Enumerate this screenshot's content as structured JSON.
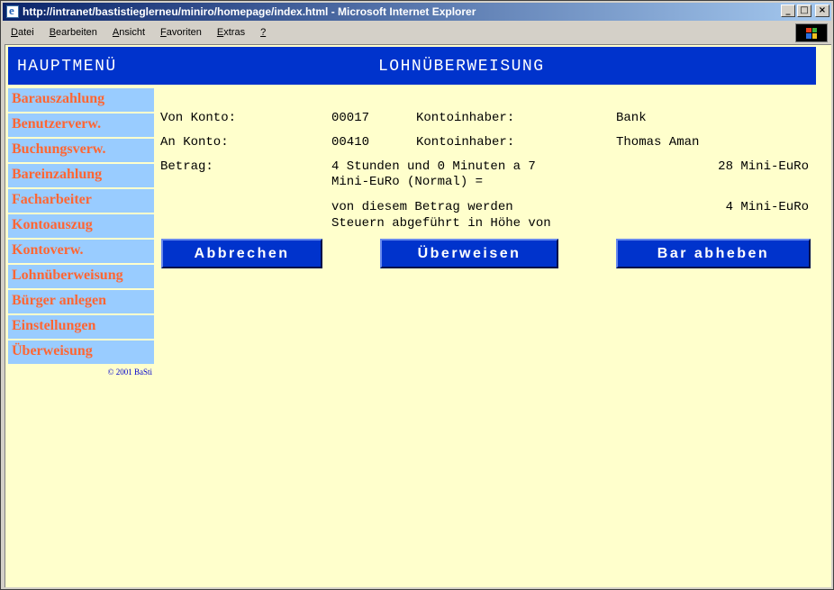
{
  "window": {
    "title": "http://intranet/bastistieglerneu/miniro/homepage/index.html - Microsoft Internet Explorer",
    "min_label": "_",
    "max_label": "□",
    "close_label": "×"
  },
  "menubar": [
    {
      "underline": "D",
      "rest": "atei"
    },
    {
      "underline": "B",
      "rest": "earbeiten"
    },
    {
      "underline": "A",
      "rest": "nsicht"
    },
    {
      "underline": "F",
      "rest": "avoriten"
    },
    {
      "underline": "E",
      "rest": "xtras"
    },
    {
      "underline": "?",
      "rest": ""
    }
  ],
  "header": {
    "left_title": "HAUPTMENÜ",
    "right_title": "LOHNÜBERWEISUNG"
  },
  "sidebar": {
    "items": [
      "Barauszahlung",
      "Benutzerverw.",
      "Buchungsverw.",
      "Bareinzahlung",
      "Facharbeiter",
      "Kontoauszug",
      "Kontoverw.",
      "Lohnüberweisung",
      "Bürger anlegen",
      "Einstellungen",
      "Überweisung"
    ],
    "copyright": "© 2001 BaSti"
  },
  "form": {
    "von_label": "Von Konto:",
    "von_value": "00017",
    "von_holder_label": "Kontoinhaber:",
    "von_holder_value": "Bank",
    "an_label": "An Konto:",
    "an_value": "00410",
    "an_holder_label": "Kontoinhaber:",
    "an_holder_value": "Thomas Aman",
    "betrag_label": "Betrag:",
    "betrag_line1": "4 Stunden und 0 Minuten a 7",
    "betrag_line2": "Mini-EuRo (Normal) =",
    "betrag_value": "28 Mini-EuRo",
    "steuer_line1": "von diesem Betrag werden",
    "steuer_line2": "Steuern abgeführt in Höhe von",
    "steuer_value": "4 Mini-EuRo"
  },
  "buttons": {
    "cancel": "Abbrechen",
    "transfer": "Überweisen",
    "withdraw": "Bar abheben"
  }
}
